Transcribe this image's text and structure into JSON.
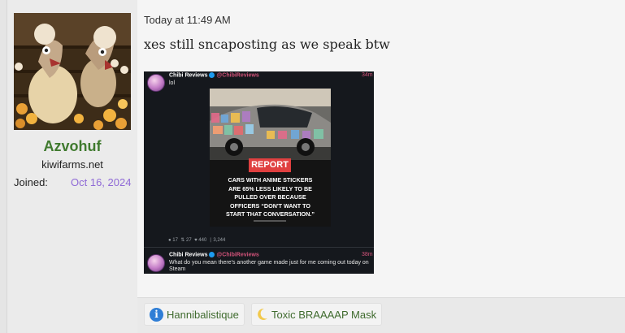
{
  "user": {
    "username": "Azvohuf",
    "title": "kiwifarms.net",
    "joined_label": "Joined:",
    "joined_value": "Oct 16, 2024"
  },
  "post": {
    "timestamp": "Today at 11:49 AM",
    "message": "xes still sncaposting as we speak btw"
  },
  "embed": {
    "tweet1": {
      "name": "Chibi Reviews",
      "handle": "@ChibiReviews",
      "time": "34m",
      "text": "lol",
      "meme_badge": "REPORT",
      "meme_lines": [
        "CARS WITH ANIME STICKERS",
        "ARE 65% LESS LIKELY TO BE",
        "PULLED OVER BECAUSE",
        "OFFICERS “DON'T WANT TO",
        "START THAT CONVERSATION.”"
      ],
      "stats": {
        "replies": "17",
        "retweets": "27",
        "likes": "440",
        "views": "3,244"
      }
    },
    "tweet2": {
      "name": "Chibi Reviews",
      "handle": "@ChibiReviews",
      "time": "38m",
      "text_line1": "What do you mean there's another game made just for me coming out today on",
      "text_line2": "Steam"
    }
  },
  "reactions": [
    {
      "icon": "info-icon",
      "label": "Hannibalistique"
    },
    {
      "icon": "crescent-moon-icon",
      "label": "Toxic BRAAAAP Mask"
    }
  ],
  "colors": {
    "username": "#3f7a2e",
    "joined_date": "#8f6ad6",
    "reaction_text": "#3f6b2e",
    "report_red": "#e04040"
  }
}
